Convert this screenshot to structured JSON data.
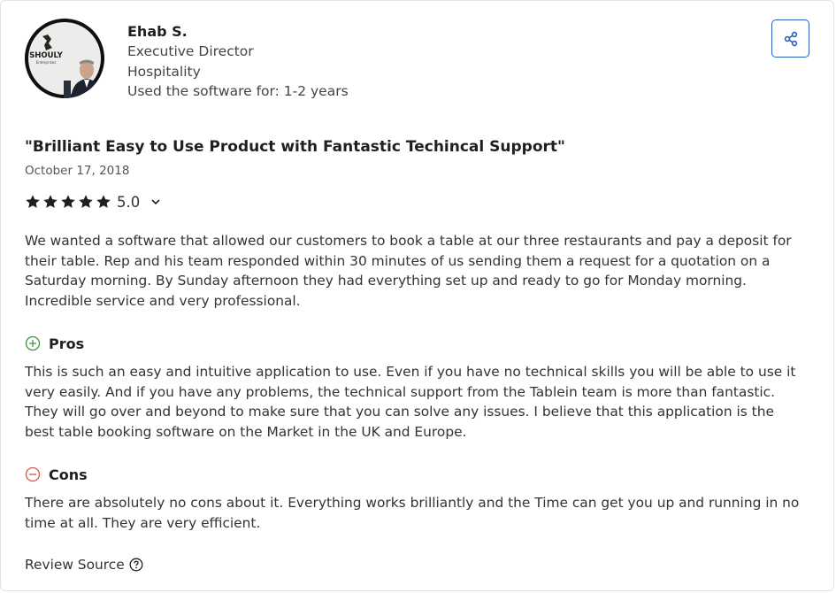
{
  "reviewer": {
    "name": "Ehab S.",
    "role": "Executive Director",
    "industry": "Hospitality",
    "usage": "Used the software for: 1-2 years",
    "avatar_logo_text": "SHOULY",
    "avatar_logo_sub": "Enterprises"
  },
  "review": {
    "title": "\"Brilliant Easy to Use Product with Fantastic Techincal Support\"",
    "date": "October 17, 2018",
    "rating": "5.0",
    "rating_value": 5,
    "body": "We wanted a software that allowed our customers to book a table at our three restaurants and pay a deposit for their table. Rep and his team responded within 30 minutes of us sending them a request for a quotation on a Saturday morning. By Sunday afternoon they had everything set up and ready to go for Monday morning. Incredible service and very professional.",
    "pros_label": "Pros",
    "pros_text": "This is such an easy and intuitive application to use. Even if you have no technical skills you will be able to use it very easily. And if you have any problems, the technical support from the Tablein team is more than fantastic. They will go over and beyond to make sure that you can solve any issues. I believe that this application is the best table booking software on the Market in the UK and Europe.",
    "cons_label": "Cons",
    "cons_text": "There are absolutely no cons about it. Everything works brilliantly and the Time can get you up and running in no time at all. They are very efficient.",
    "source_label": "Review Source"
  },
  "icons": {
    "share": "share-icon",
    "star": "star-icon",
    "chevron": "chevron-down-icon",
    "pros": "plus-circle-icon",
    "cons": "minus-circle-icon",
    "help": "question-circle-icon"
  },
  "colors": {
    "accent": "#2a5db8",
    "pros": "#3f9142",
    "cons": "#d9534f",
    "star": "#1f1f1f"
  }
}
